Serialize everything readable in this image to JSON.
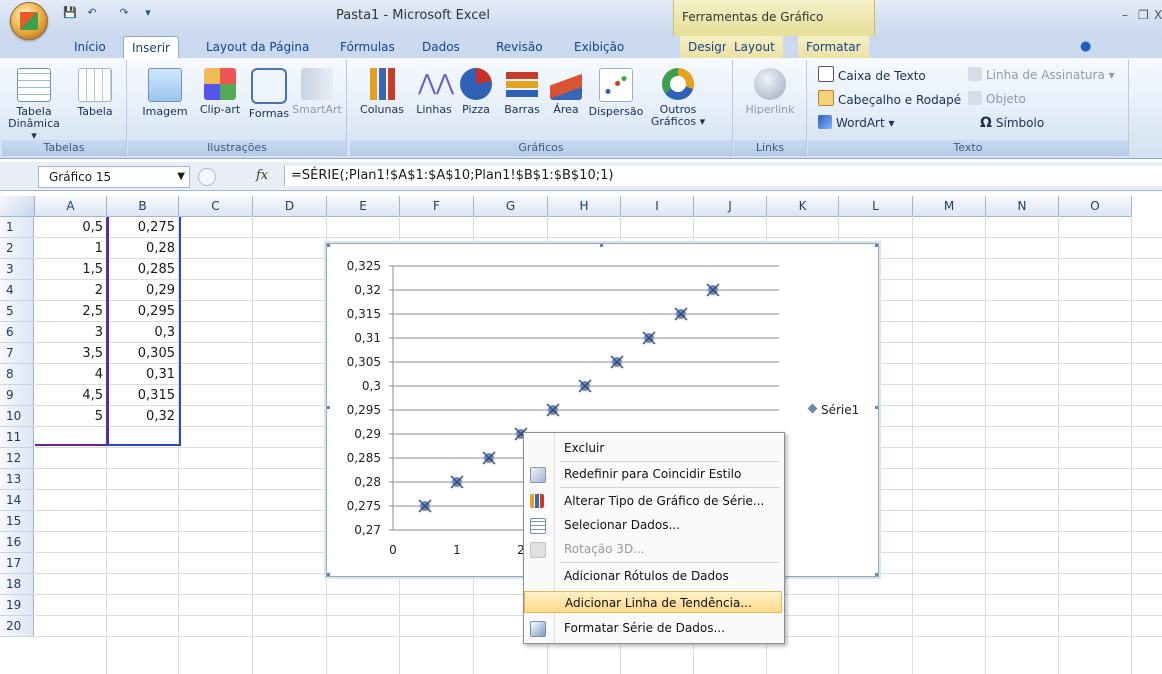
{
  "titlebar": {
    "title": "Pasta1 - Microsoft Excel",
    "context_tools": "Ferramentas de Gráfico",
    "qat_save": "💾",
    "qat_undo": "↶",
    "qat_redo": "↷",
    "qat_more": "▾",
    "minimize": "–",
    "restore": "❐",
    "close": "X"
  },
  "tabs": [
    {
      "label": "Início"
    },
    {
      "label": "Inserir"
    },
    {
      "label": "Layout da Página"
    },
    {
      "label": "Fórmulas"
    },
    {
      "label": "Dados"
    },
    {
      "label": "Revisão"
    },
    {
      "label": "Exibição"
    },
    {
      "label": "Design"
    },
    {
      "label": "Layout"
    },
    {
      "label": "Formatar"
    }
  ],
  "ribbon": {
    "groups": {
      "tabelas": "Tabelas",
      "ilustracoes": "Ilustrações",
      "graficos": "Gráficos",
      "links": "Links",
      "texto": "Texto"
    },
    "buttons": {
      "tabela_dinamica": "Tabela Dinâmica ▾",
      "tabela": "Tabela",
      "imagem": "Imagem",
      "clipart": "Clip-art",
      "formas": "Formas",
      "smartart": "SmartArt",
      "colunas": "Colunas",
      "linhas": "Linhas",
      "pizza": "Pizza",
      "barras": "Barras",
      "area": "Área",
      "dispersao": "Dispersão",
      "outros": "Outros Gráficos ▾",
      "hiperlink": "Hiperlink",
      "caixa_texto": "Caixa de Texto",
      "cabecalho": "Cabeçalho e Rodapé",
      "wordart": "WordArt ▾",
      "linha_assinatura": "Linha de Assinatura ▾",
      "objeto": "Objeto",
      "simbolo": "Símbolo"
    }
  },
  "formula_bar": {
    "name_box": "Gráfico 15",
    "fx": "fx",
    "formula": "=SÉRIE(;Plan1!$A$1:$A$10;Plan1!$B$1:$B$10;1)"
  },
  "sheet": {
    "columns": [
      "A",
      "B",
      "C",
      "D",
      "E",
      "F",
      "G",
      "H",
      "I",
      "J",
      "K",
      "L",
      "M",
      "N",
      "O"
    ],
    "rows": [
      "1",
      "2",
      "3",
      "4",
      "5",
      "6",
      "7",
      "8",
      "9",
      "10",
      "11",
      "12",
      "13",
      "14",
      "15",
      "16",
      "17",
      "18",
      "19",
      "20"
    ],
    "colA": [
      "0,5",
      "1",
      "1,5",
      "2",
      "2,5",
      "3",
      "3,5",
      "4",
      "4,5",
      "5"
    ],
    "colB": [
      "0,275",
      "0,28",
      "0,285",
      "0,29",
      "0,295",
      "0,3",
      "0,305",
      "0,31",
      "0,315",
      "0,32"
    ]
  },
  "chart_data": {
    "type": "scatter",
    "series": [
      {
        "name": "Série1",
        "x": [
          0.5,
          1,
          1.5,
          2,
          2.5,
          3,
          3.5,
          4,
          4.5,
          5
        ],
        "y": [
          0.275,
          0.28,
          0.285,
          0.29,
          0.295,
          0.3,
          0.305,
          0.31,
          0.315,
          0.32
        ]
      }
    ],
    "ylim": [
      0.27,
      0.325
    ],
    "y_ticks": [
      "0,325",
      "0,32",
      "0,315",
      "0,31",
      "0,305",
      "0,3",
      "0,295",
      "0,29",
      "0,285",
      "0,28",
      "0,275",
      "0,27"
    ],
    "x_ticks": [
      "0",
      "1",
      "2"
    ],
    "grid": true,
    "legend": "right",
    "legend_label": "Série1"
  },
  "context_menu": {
    "items": [
      {
        "label": "Excluir",
        "enabled": true
      },
      {
        "label": "Redefinir para Coincidir Estilo",
        "enabled": true
      },
      {
        "label": "Alterar Tipo de Gráfico de Série...",
        "enabled": true
      },
      {
        "label": "Selecionar Dados...",
        "enabled": true
      },
      {
        "label": "Rotação 3D...",
        "enabled": false
      },
      {
        "label": "Adicionar Rótulos de Dados",
        "enabled": true
      },
      {
        "label": "Adicionar Linha de Tendência...",
        "enabled": true,
        "highlighted": true
      },
      {
        "label": "Formatar Série de Dados...",
        "enabled": true
      }
    ]
  },
  "colors": {
    "marker": "#6b8ab3",
    "highlight": "#ffd98a",
    "ribbon_bg": "#dbe7f6"
  }
}
